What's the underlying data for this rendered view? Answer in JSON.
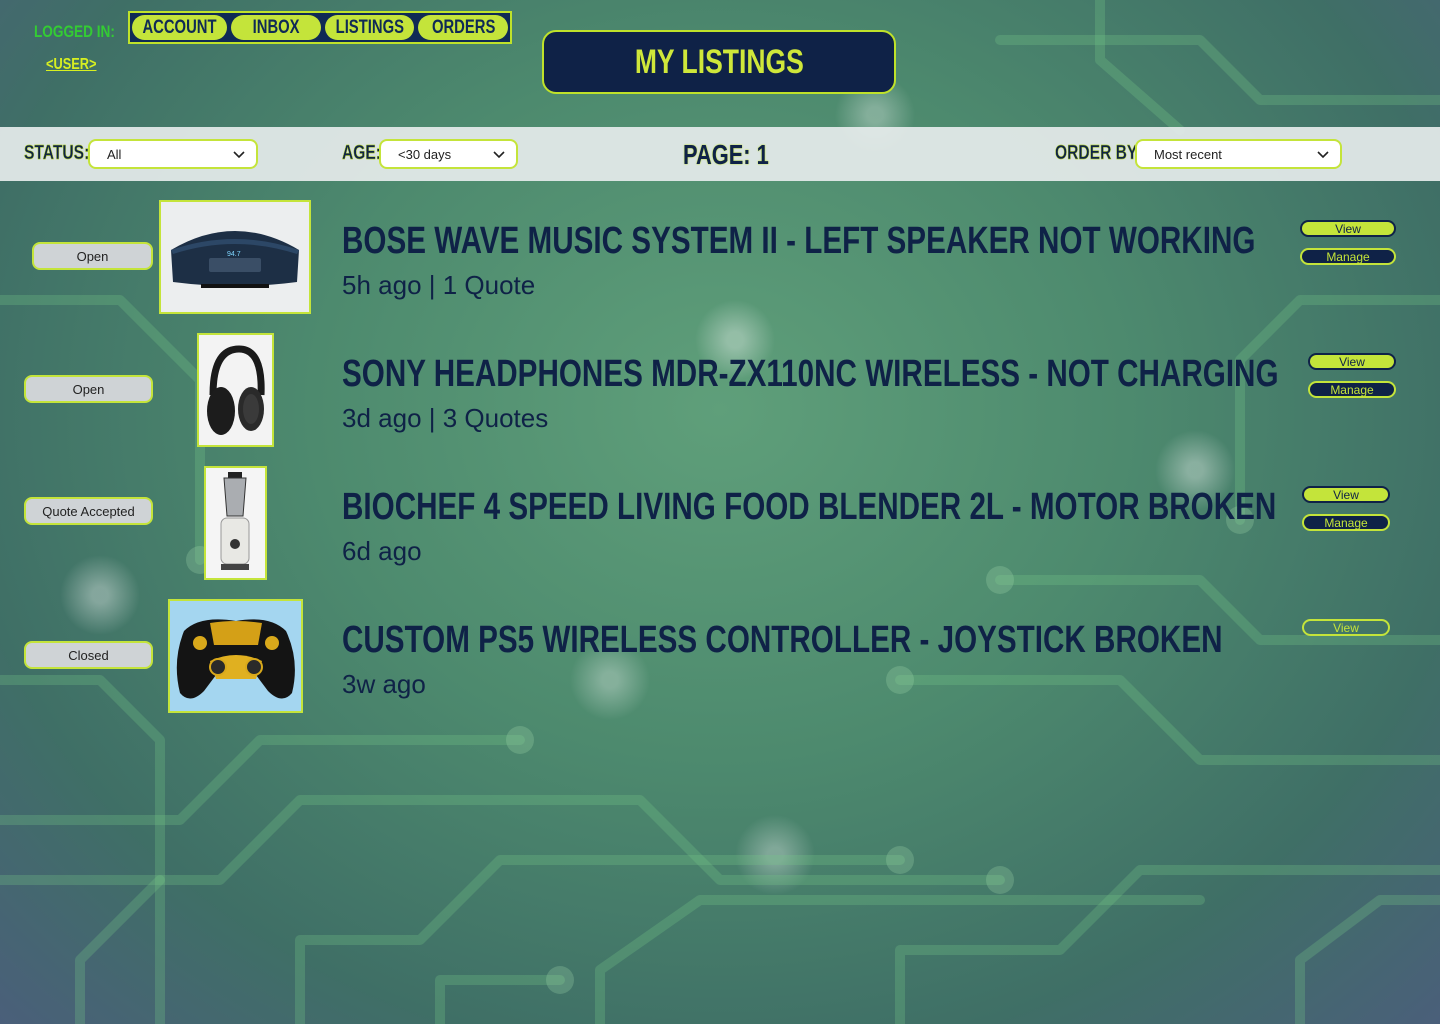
{
  "header": {
    "logged_in_label": "LOGGED IN:",
    "user_link": "<USER>",
    "nav": [
      "ACCOUNT",
      "INBOX",
      "LISTINGS",
      "ORDERS"
    ],
    "page_title": "MY LISTINGS"
  },
  "filters": {
    "status_label": "STATUS:",
    "status_value": "All",
    "age_label": "AGE:",
    "age_value": "<30 days",
    "page_label": "PAGE: 1",
    "order_label": "ORDER BY:",
    "order_value": "Most recent"
  },
  "listings": [
    {
      "status": "Open",
      "title": "BOSE WAVE MUSIC SYSTEM II - LEFT SPEAKER NOT WORKING",
      "meta": "5h ago | 1 Quote",
      "view_label": "View",
      "manage_label": "Manage",
      "image": "speaker-photo"
    },
    {
      "status": "Open",
      "title": "SONY HEADPHONES MDR-ZX110NC WIRELESS - NOT CHARGING",
      "meta": "3d ago | 3 Quotes",
      "view_label": "View",
      "manage_label": "Manage",
      "image": "headphones-photo"
    },
    {
      "status": "Quote Accepted",
      "title": "BIOCHEF 4 SPEED LIVING FOOD BLENDER 2L - MOTOR BROKEN",
      "meta": "6d ago",
      "view_label": "View",
      "manage_label": "Manage",
      "image": "blender-photo"
    },
    {
      "status": "Closed",
      "title": "CUSTOM PS5 WIRELESS CONTROLLER - JOYSTICK BROKEN",
      "meta": "3w ago",
      "view_label": "View",
      "image": "controller-photo"
    }
  ],
  "colors": {
    "accent": "#c4e43a",
    "navy": "#0f2247",
    "logged_in_green": "#33cc33"
  }
}
